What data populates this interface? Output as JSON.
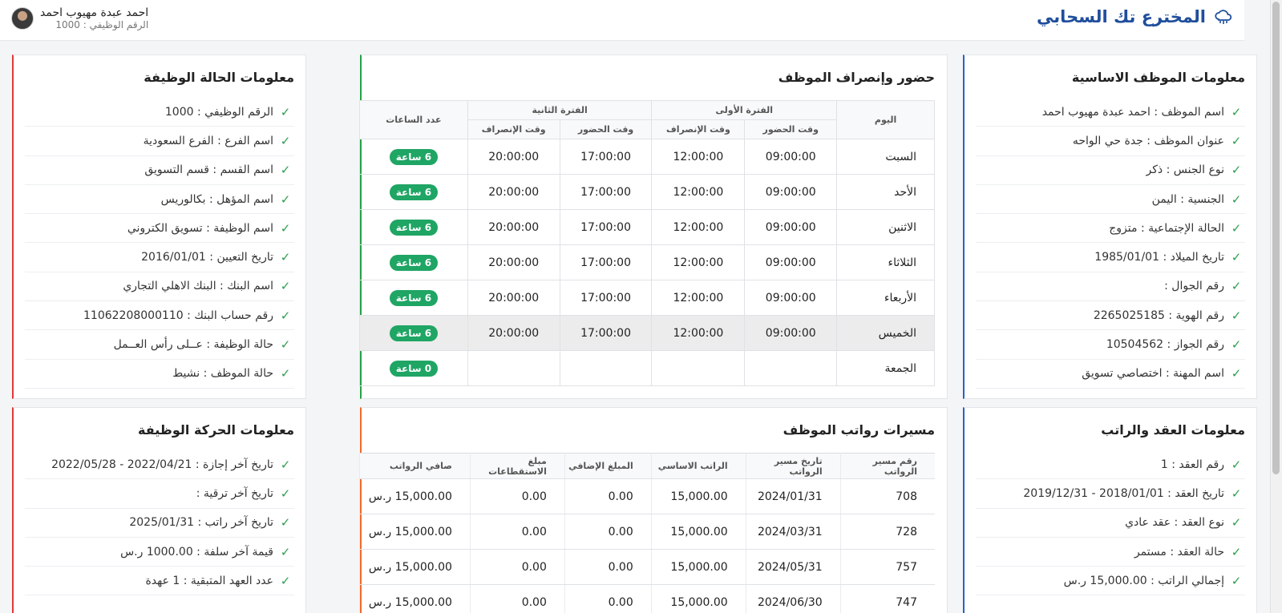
{
  "header": {
    "title": "المخترع تك السحابي",
    "user_name": "احمد عبدة مهيوب احمد",
    "user_empno": "الرقم الوظيفي : 1000"
  },
  "basic_info": {
    "title": "معلومات الموظف الاساسية",
    "items": [
      "اسم الموظف : احمد عبدة مهيوب احمد",
      "عنوان الموظف : جدة حي الواحه",
      "نوع الجنس : ذكر",
      "الجنسية : اليمن",
      "الحالة الإجتماعية : متزوج",
      "تاريخ الميلاد : 1985/01/01",
      "رقم الجوال :",
      "رقم الهوية : 2265025185",
      "رقم الجواز : 10504562",
      "اسم المهنة : اختصاصي تسويق"
    ]
  },
  "attendance": {
    "title": "حضور وإنصراف الموظف",
    "h_day": "اليوم",
    "h_period1": "الفترة الأولى",
    "h_period2": "الفترة الثانية",
    "h_hours": "عدد الساعات",
    "h_in": "وقت الحضور",
    "h_out": "وقت الإنصراف",
    "rows": [
      {
        "day": "السبت",
        "in1": "09:00:00",
        "out1": "12:00:00",
        "in2": "17:00:00",
        "out2": "20:00:00",
        "hours": "6 ساعة"
      },
      {
        "day": "الأحد",
        "in1": "09:00:00",
        "out1": "12:00:00",
        "in2": "17:00:00",
        "out2": "20:00:00",
        "hours": "6 ساعة"
      },
      {
        "day": "الاثنين",
        "in1": "09:00:00",
        "out1": "12:00:00",
        "in2": "17:00:00",
        "out2": "20:00:00",
        "hours": "6 ساعة"
      },
      {
        "day": "الثلاثاء",
        "in1": "09:00:00",
        "out1": "12:00:00",
        "in2": "17:00:00",
        "out2": "20:00:00",
        "hours": "6 ساعة"
      },
      {
        "day": "الأربعاء",
        "in1": "09:00:00",
        "out1": "12:00:00",
        "in2": "17:00:00",
        "out2": "20:00:00",
        "hours": "6 ساعة"
      },
      {
        "day": "الخميس",
        "in1": "09:00:00",
        "out1": "12:00:00",
        "in2": "17:00:00",
        "out2": "20:00:00",
        "hours": "6 ساعة"
      },
      {
        "day": "الجمعة",
        "in1": "",
        "out1": "",
        "in2": "",
        "out2": "",
        "hours": "0 ساعة"
      }
    ]
  },
  "job_status": {
    "title": "معلومات الحالة الوظيفة",
    "items": [
      "الرقم الوظيفي : 1000",
      "اسم الفرع : الفرع السعودية",
      "اسم القسم : قسم التسويق",
      "اسم المؤهل : بكالوريس",
      "اسم الوظيفة : تسويق الكتروني",
      "تاريخ التعيين : 2016/01/01",
      "اسم البنك : البنك الاهلي التجاري",
      "رقم حساب البنك : 11062208000110",
      "حالة الوظيفة : عــلى رأس العــمل",
      "حالة الموظف : نشيط"
    ]
  },
  "contract": {
    "title": "معلومات العقد والراتب",
    "items": [
      "رقم العقد : 1",
      "تاريخ العقد : 2018/01/01 - 2019/12/31",
      "نوع العقد : عقد عادي",
      "حالة العقد : مستمر",
      "إجمالي الراتب : 15,000.00 ر.س"
    ]
  },
  "payroll": {
    "title": "مسيرات رواتب الموظف",
    "headers": [
      "رقم مسير الرواتب",
      "تاريخ مسير الرواتب",
      "الراتب الاساسي",
      "المبلغ الإضافي",
      "مبلغ الاستقطاعات",
      "صافي الرواتب"
    ],
    "rows": [
      [
        "708",
        "2024/01/31",
        "15,000.00",
        "0.00",
        "0.00",
        "15,000.00 ر.س"
      ],
      [
        "728",
        "2024/03/31",
        "15,000.00",
        "0.00",
        "0.00",
        "15,000.00 ر.س"
      ],
      [
        "757",
        "2024/05/31",
        "15,000.00",
        "0.00",
        "0.00",
        "15,000.00 ر.س"
      ],
      [
        "747",
        "2024/06/30",
        "15,000.00",
        "0.00",
        "0.00",
        "15,000.00 ر.س"
      ]
    ]
  },
  "movement": {
    "title": "معلومات الحركة الوظيفة",
    "items": [
      "تاريخ آخر إجازة : 2022/04/21 - 2022/05/28",
      "تاريخ آخر ترقية :",
      "تاريخ آخر راتب : 2025/01/31",
      "قيمة آخر سلفة : 1000.00 ر.س",
      "عدد العهد المتبقية : 1 عهدة"
    ]
  }
}
